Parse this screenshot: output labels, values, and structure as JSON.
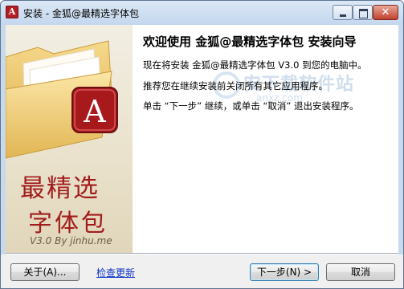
{
  "window": {
    "title": "安装 - 金狐@最精选字体包",
    "app_icon_letter": "A",
    "close_glyph": "✕"
  },
  "sidebar": {
    "logo_letter": "A",
    "brand_line1": "最精选",
    "brand_line2": "字体包",
    "version_line": "V3.0 By jinhu.me"
  },
  "main": {
    "heading": "欢迎使用  金狐@最精选字体包  安装向导",
    "paragraph1": "现在将安装 金狐@最精选字体包 V3.0 到您的电脑中。",
    "paragraph2": "推荐您在继续安装前关闭所有其它应用程序。",
    "paragraph3": "单击 “下一步” 继续，或单击 “取消” 退出安装程序。",
    "watermark_text": "安下载软件站",
    "watermark_url": "anxz.com"
  },
  "footer": {
    "about_label": "关于(A)...",
    "update_link": "检查更新",
    "next_label": "下一步(N) >",
    "cancel_label": "取消"
  },
  "colors": {
    "brand_red": "#a21c1c",
    "link_blue": "#0b33c8",
    "title_bar": "#c9d9ec"
  }
}
